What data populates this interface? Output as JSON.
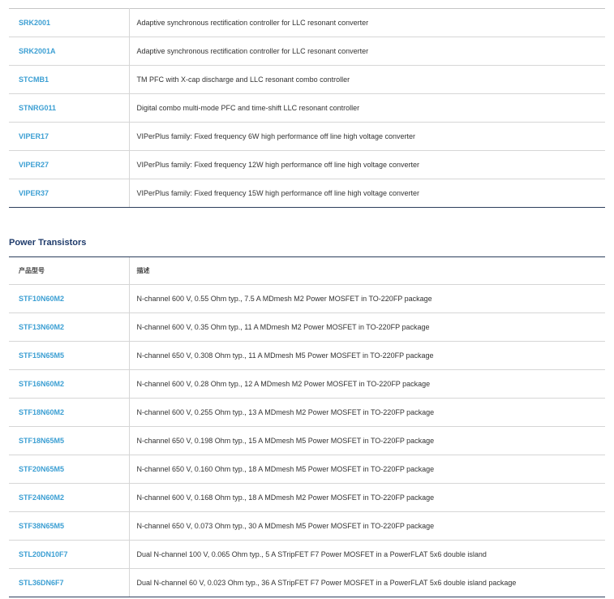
{
  "top_table": {
    "rows": [
      {
        "part": "SRK2001",
        "desc": "Adaptive synchronous rectification controller for LLC resonant converter"
      },
      {
        "part": "SRK2001A",
        "desc": "Adaptive synchronous rectification controller for LLC resonant converter"
      },
      {
        "part": "STCMB1",
        "desc": "TM PFC with X-cap discharge and LLC resonant combo controller"
      },
      {
        "part": "STNRG011",
        "desc": "Digital combo multi-mode PFC and time-shift LLC resonant controller"
      },
      {
        "part": "VIPER17",
        "desc": "VIPerPlus family: Fixed frequency 6W high performance off line high voltage converter"
      },
      {
        "part": "VIPER27",
        "desc": "VIPerPlus family: Fixed frequency 12W high performance off line high voltage converter"
      },
      {
        "part": "VIPER37",
        "desc": "VIPerPlus family: Fixed frequency 15W high performance off line high voltage converter"
      }
    ]
  },
  "power_transistors": {
    "title": "Power Transistors",
    "headers": {
      "part": "产品型号",
      "desc": "描述"
    },
    "rows": [
      {
        "part": "STF10N60M2",
        "desc": "N-channel 600 V, 0.55 Ohm typ., 7.5 A MDmesh M2 Power MOSFET in TO-220FP package"
      },
      {
        "part": "STF13N60M2",
        "desc": "N-channel 600 V, 0.35 Ohm typ., 11 A MDmesh M2 Power MOSFET in TO-220FP package"
      },
      {
        "part": "STF15N65M5",
        "desc": "N-channel 650 V, 0.308 Ohm typ., 11 A MDmesh M5 Power MOSFET in TO-220FP package"
      },
      {
        "part": "STF16N60M2",
        "desc": "N-channel 600 V, 0.28 Ohm typ., 12 A MDmesh M2 Power MOSFET in TO-220FP package"
      },
      {
        "part": "STF18N60M2",
        "desc": "N-channel 600 V, 0.255 Ohm typ., 13 A MDmesh M2 Power MOSFET in TO-220FP package"
      },
      {
        "part": "STF18N65M5",
        "desc": "N-channel 650 V, 0.198 Ohm typ., 15 A MDmesh M5 Power MOSFET in TO-220FP package"
      },
      {
        "part": "STF20N65M5",
        "desc": "N-channel 650 V, 0.160 Ohm typ., 18 A MDmesh M5 Power MOSFET in TO-220FP package"
      },
      {
        "part": "STF24N60M2",
        "desc": "N-channel 600 V, 0.168 Ohm typ., 18 A MDmesh M2 Power MOSFET in TO-220FP package"
      },
      {
        "part": "STF38N65M5",
        "desc": "N-channel 650 V, 0.073 Ohm typ., 30 A MDmesh M5 Power MOSFET in TO-220FP package"
      },
      {
        "part": "STL20DN10F7",
        "desc": "Dual N-channel 100 V, 0.065 Ohm typ., 5 A STripFET F7 Power MOSFET in a PowerFLAT 5x6 double island"
      },
      {
        "part": "STL36DN6F7",
        "desc": "Dual N-channel 60 V, 0.023 Ohm typ., 36 A STripFET F7 Power MOSFET in a PowerFLAT 5x6 double island package"
      }
    ]
  },
  "colors": {
    "link": "#3c9fd3",
    "section_title": "#1f3b6b",
    "rule_dark": "#2c3e5c",
    "row_border": "#d6d6d6"
  }
}
